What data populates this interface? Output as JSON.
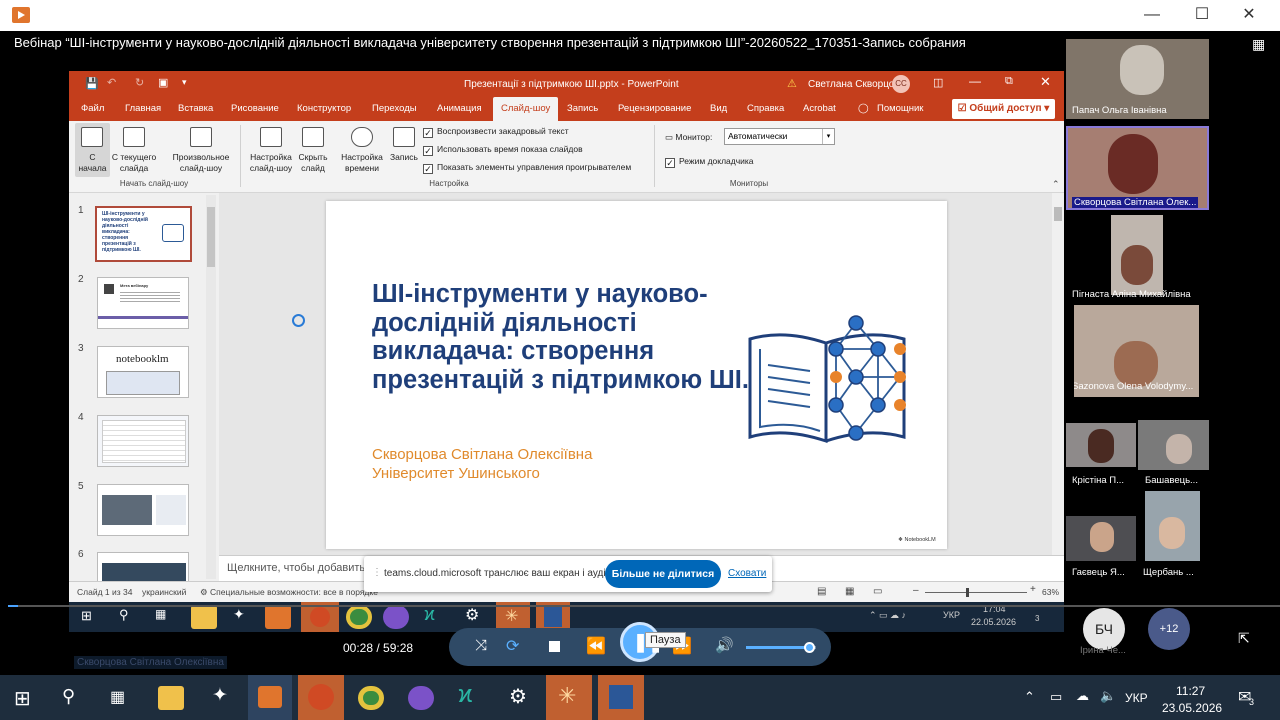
{
  "player": {
    "window_title": "Вебінар “ШІ-інструменти у науково-дослідній діяльності викладача університету створення  презентацій з підтримкою ШІ”-20260522_170351-Запись собрания",
    "time_display": "00:28 / 59:28",
    "pause_tooltip": "Пауза",
    "progress_fraction": 0.008,
    "volume_fraction": 0.9
  },
  "ppt": {
    "window_title": "Презентації з підтримкою ШІ.pptx  -  PowerPoint",
    "user_name": "Светлана Скворцова",
    "user_initials": "СС",
    "tabs": [
      "Файл",
      "Главная",
      "Вставка",
      "Рисование",
      "Конструктор",
      "Переходы",
      "Анимация",
      "Слайд-шоу",
      "Запись",
      "Рецензирование",
      "Вид",
      "Справка",
      "Acrobat",
      "Помощник"
    ],
    "share_label": "Общий доступ",
    "ribbon": {
      "from_start": "С начала",
      "from_current": "С текущего слайда",
      "custom_show": "Произвольное слайд-шоу",
      "group_start": "Начать слайд-шоу",
      "setup_show": "Настройка слайд-шоу",
      "hide_slide": "Скрыть слайд",
      "rehearse": "Настройка времени",
      "record": "Запись",
      "chk_narration": "Воспроизвести закадровый текст",
      "chk_timings": "Использовать время показа слайдов",
      "chk_media": "Показать элементы управления проигрывателем",
      "group_setup": "Настройка",
      "monitor_label": "Монитор:",
      "monitor_value": "Автоматически",
      "presenter_view": "Режим докладчика",
      "group_monitors": "Мониторы"
    },
    "thumbs": [
      {
        "num": "1",
        "text": "ШІ-інструменти у науково-дослідній діяльності викладача: створення презентацій з підтримкою ШІ."
      },
      {
        "num": "2",
        "text": "Мета вебінару"
      },
      {
        "num": "3",
        "text": "notebooklm"
      },
      {
        "num": "4",
        "text": ""
      },
      {
        "num": "5",
        "text": ""
      },
      {
        "num": "6",
        "text": ""
      }
    ],
    "slide": {
      "title": "ШІ-інструменти у науково-дослідній діяльності викладача: створення презентацій з підтримкою ШІ.",
      "author": "Скворцова Світлана Олексіївна",
      "university": "Університет Ушинського",
      "watermark": "NotebookLM"
    },
    "notes_placeholder": "Щелкните, чтобы добавить",
    "status": {
      "slide_count": "Слайд 1 из 34",
      "language": "украинский",
      "accessibility": "Специальные возможности: все в порядке",
      "zoom": "63%"
    }
  },
  "share_banner": {
    "text": "teams.cloud.microsoft транслює ваш екран і аудіо.",
    "stop_label": "Більше не ділитися",
    "hide_label": "Сховати"
  },
  "inner_taskbar": {
    "lang": "УКР",
    "time": "17:04",
    "date": "22.05.2026",
    "notif": "3"
  },
  "presenter_name": "Скворцова Світлана Олексіївна",
  "participants": [
    {
      "name": "Папач Ольга Іванівна"
    },
    {
      "name": "Скворцова Світлана Олек..."
    },
    {
      "name": "Пігнаста Аліна Михайлівна"
    },
    {
      "name": "Sazonova Olena Volodymy..."
    },
    {
      "name": "Крістіна П..."
    },
    {
      "name": "Башавець..."
    },
    {
      "name": "Гаєвець Я..."
    },
    {
      "name": "Щербань ..."
    },
    {
      "name": "Ірина Че..."
    }
  ],
  "avatar_initials": "БЧ",
  "more_count": "+12",
  "taskbar": {
    "lang": "УКР",
    "time": "11:27",
    "date": "23.05.2026",
    "notif": "3"
  }
}
